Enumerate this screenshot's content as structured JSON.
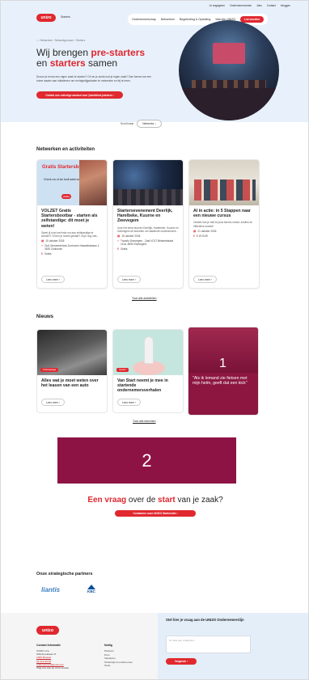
{
  "topnav": [
    "Je engageren",
    "Ondernemersclubs",
    "Jobs",
    "Contact",
    "Inloggen"
  ],
  "header": {
    "logo": "unizo",
    "logo_sub": "Starters",
    "nav": [
      "Ondernemerschap",
      "Netwerken",
      "Begeleiding & Opleiding",
      "Wat zijn UNIZO"
    ],
    "cta": "Lid worden"
  },
  "hero": {
    "breadcrumb": "⌂  ›  Netwerken  ›  Netwerkgroepen  ›  Starters",
    "title_pre": "Wij brengen ",
    "title_red1": "pre-starters",
    "title_mid": " en ",
    "title_red2": "starters",
    "title_post": " samen",
    "intro": "Droom je ervan een eigen zaak te starten? Of run je sinds kort je eigen zaak? Dan kiezen we een ruime waaier aan initiatieven om rechtgedijgedaden te netwerken en bij te leren.",
    "button": "Ontdek ons volledige aanbod voor (hardblind-)starters  ›",
    "scroll_label": "Scroll naar",
    "scroll_pill": "Netwerks  ↓"
  },
  "events": {
    "heading": "Netwerken en activiteiten",
    "cards": [
      {
        "img_title": "Gratis Startersbootbar",
        "img_sub": "Check uw of\nzie bodt aalst ven",
        "img_logo": "unizo",
        "title": "VOLZET Gratis Startersbootbar - starten als zelfstandige: dit moet je weten!",
        "desc": "Speel jij rond met leke om aan zelfstandige te worden? Of ben je recent gestart? Zit je nog met...",
        "date": "15 oktober 2026",
        "place": "Oud Gemeentehuis Zonhoven Hasseltsebaan 2, 3520 Zonhoven",
        "price": "Gratis",
        "more": "Lees meer  ›"
      },
      {
        "title": "Startersevenement Deerlijk, Harelbeke, Kuurne en Zwevegem",
        "desc": "Voor het eerst bunnen Deerlijk, Harelbeke, Kuurne en Zwevegem de krachten om startende ondernemers...",
        "date": "15 oktober 2026",
        "place": "Transfo Zwevegem - Zaal VOLT Bekaertstraat 112a, 8550 Zwevegem",
        "price": "Gratis",
        "more": "Lees meer  ›"
      },
      {
        "title": "AI in actie: in 5 Stappen naar een nieuwe cursus",
        "desc": "Ontdek hoe je met AI jouw kennis omzet, snellen en effectieve manier!",
        "date": "21 oktober 2026",
        "price": "€ 19 EUR",
        "more": "Lees meer  ›"
      }
    ],
    "all_link": "Toon alle activiteiten"
  },
  "news": {
    "heading": "Nieuws",
    "cards": [
      {
        "tag": "Publicapelage",
        "title": "Alles wat je moet weten over het leasen van een auto",
        "more": "Lees meer  ›"
      },
      {
        "tag": "Opstart",
        "title": "Van Start neemt je mee in startende ondernemersverhalen",
        "more": "Lees meer  ›"
      },
      {
        "title": "\"Als ik lemand zie fietsen met mijn helm, geeft dat een kick\"",
        "overlay_number": "1"
      }
    ],
    "all_link": "Toon alle berichten"
  },
  "banner": {
    "number": "2"
  },
  "question": {
    "red1": "Een vraag",
    "mid": " over de ",
    "red2": "start",
    "post": " van je zaak?",
    "button": "Contacteer onze UNIZO Startersliin  ›"
  },
  "partners": {
    "heading": "Onze strategische partners",
    "p1": "liantis",
    "p2": "KBC"
  },
  "footer": {
    "logo": "unizo",
    "contact_h": "Contact Informatie",
    "contact_name": "UNIZO vzw",
    "contact_street": "Willebroekkaai 37",
    "contact_city": "1000 Brussel",
    "contact_phone": "02 212 25 00",
    "contact_mail": "ondernemersl@unizo.be",
    "contact_extra": "Volg ons ook op onze sociale",
    "nuttig_h": "Nuttig",
    "nuttig": [
      "Partners",
      "Pers",
      "Vacatures",
      "Onderwijs & ondernemen",
      "Tools"
    ],
    "q_title": "Stel hier je vraag aan de UNIZO Ondernemerslijn",
    "q_placeholder": "Te hebt een vraag hier...",
    "q_button": "Volgende  ›"
  },
  "colors": {
    "brand_red": "#e0282f",
    "overlay": "#8e1345",
    "hero_bg": "#e8f1fb"
  }
}
